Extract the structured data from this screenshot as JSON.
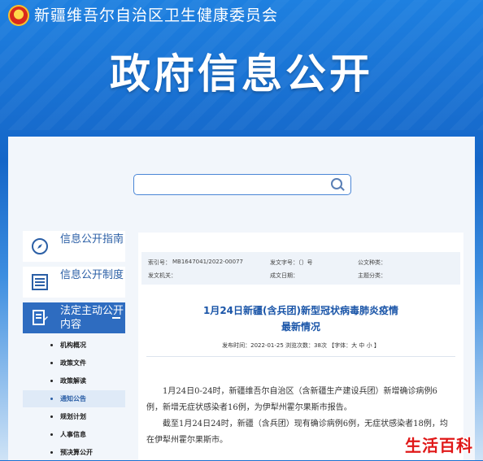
{
  "header": {
    "site_title": "新疆维吾尔自治区卫生健康委员会",
    "hero_title": "政府信息公开"
  },
  "search": {
    "placeholder": ""
  },
  "sidebar": {
    "items": [
      {
        "label": "信息公开指南",
        "icon": "compass-icon"
      },
      {
        "label": "信息公开制度",
        "icon": "list-icon"
      },
      {
        "label": "法定主动公开内容",
        "icon": "document-edit-icon",
        "active": true
      }
    ],
    "sub_items": [
      "机构概况",
      "政策文件",
      "政策解读",
      "通知公告",
      "规划计划",
      "人事信息",
      "预决算公开"
    ],
    "selected_sub": "通知公告"
  },
  "article": {
    "meta": {
      "index_label": "索引号：",
      "index_value": "MB1647041/2022-00077",
      "doc_no_label": "发文字号：〔〕号",
      "category_label": "公文种类：",
      "issuer_label": "发文机关：",
      "date_label": "成文日期：",
      "topic_label": "主题分类："
    },
    "title_line1": "1月24日新疆(含兵团)新型冠状病毒肺炎疫情",
    "title_line2": "最新情况",
    "pub_info": "发布时间：2022-01-25    浏览次数：38次    【字体：大 中 小 】",
    "paragraphs": [
      "1月24日0-24时，新疆维吾尔自治区（含新疆生产建设兵团）新增确诊病例6例，新增无症状感染者16例，为伊犁州霍尔果斯市报告。",
      "截至1月24日24时，新疆（含兵团）现有确诊病例6例，无症状感染者18例，均在伊犁州霍尔果斯市。"
    ]
  },
  "watermark": "生活百科",
  "colors": {
    "brand_blue": "#1566c8",
    "title_blue": "#1a55a8",
    "active_nav": "#2e6cc0",
    "watermark_red": "#e01818"
  }
}
